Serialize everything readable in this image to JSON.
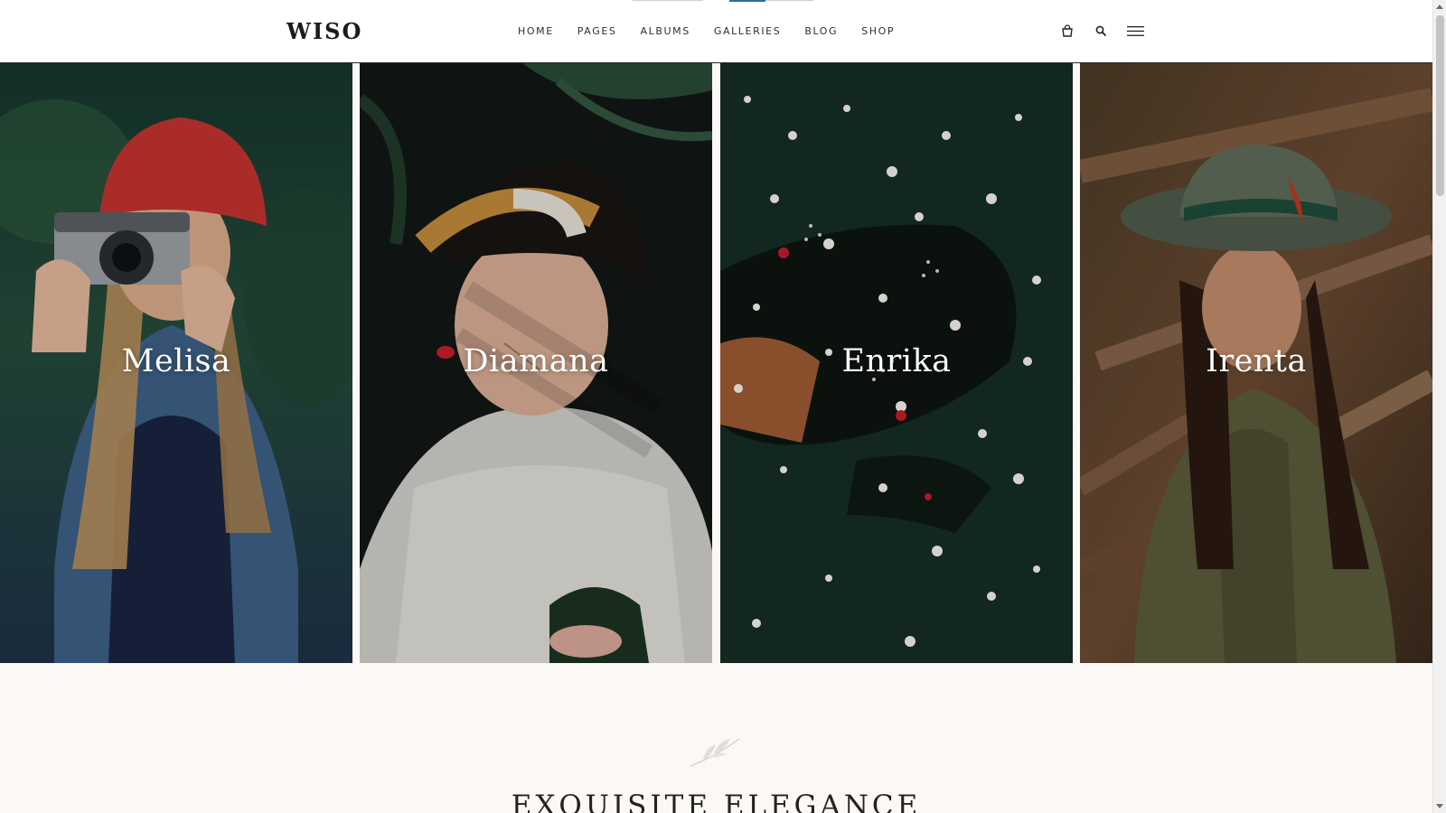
{
  "header": {
    "logo": "WISO",
    "nav": [
      {
        "label": "HOME",
        "active": false
      },
      {
        "label": "PAGES",
        "active": false
      },
      {
        "label": "ALBUMS",
        "active": false
      },
      {
        "label": "GALLERIES",
        "active": true
      },
      {
        "label": "BLOG",
        "active": false
      },
      {
        "label": "SHOP",
        "active": false
      }
    ],
    "icons": [
      "cart-icon",
      "search-icon",
      "menu-icon"
    ],
    "accent_color": "#2b6fa8"
  },
  "gallery": {
    "models": [
      {
        "name": "Melisa"
      },
      {
        "name": "Diamana"
      },
      {
        "name": "Enrika"
      },
      {
        "name": "Irenta"
      }
    ]
  },
  "section": {
    "icon": "leaf-icon",
    "title": "EXQUISITE ELEGANCE"
  }
}
